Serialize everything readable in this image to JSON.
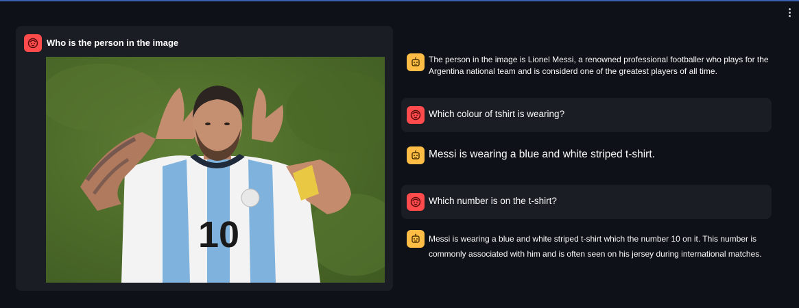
{
  "app": {
    "menu_icon": "kebab-menu-icon",
    "colors": {
      "background": "#0e1117",
      "panel": "#1a1d24",
      "user_avatar": "#ff4b4b",
      "assistant_avatar": "#ffbd45",
      "top_accent": "#3b5fb0"
    }
  },
  "first_message": {
    "role": "user",
    "avatar_icon": "user-face-icon",
    "text": "Who is the person in the image",
    "image": {
      "subject": "football-player-photo",
      "jersey_number": "10"
    }
  },
  "messages": [
    {
      "role": "assistant",
      "avatar_icon": "bot-face-icon",
      "text": "The person in the image is Lionel Messi, a renowned professional  footballer who plays for the Argentina national team and is considerd one of the greatest players of all time."
    },
    {
      "role": "user",
      "avatar_icon": "user-face-icon",
      "text": "Which colour of tshirt is wearing?"
    },
    {
      "role": "assistant",
      "avatar_icon": "bot-face-icon",
      "text": "Messi is wearing a blue and white striped t-shirt."
    },
    {
      "role": "user",
      "avatar_icon": "user-face-icon",
      "text": "Which number is on the t-shirt?"
    },
    {
      "role": "assistant",
      "avatar_icon": "bot-face-icon",
      "text": "Messi is wearing a blue and white striped t-shirt which the number 10 on it. This number is commonly associated with him and is often seen on his jersey during international matches."
    }
  ]
}
